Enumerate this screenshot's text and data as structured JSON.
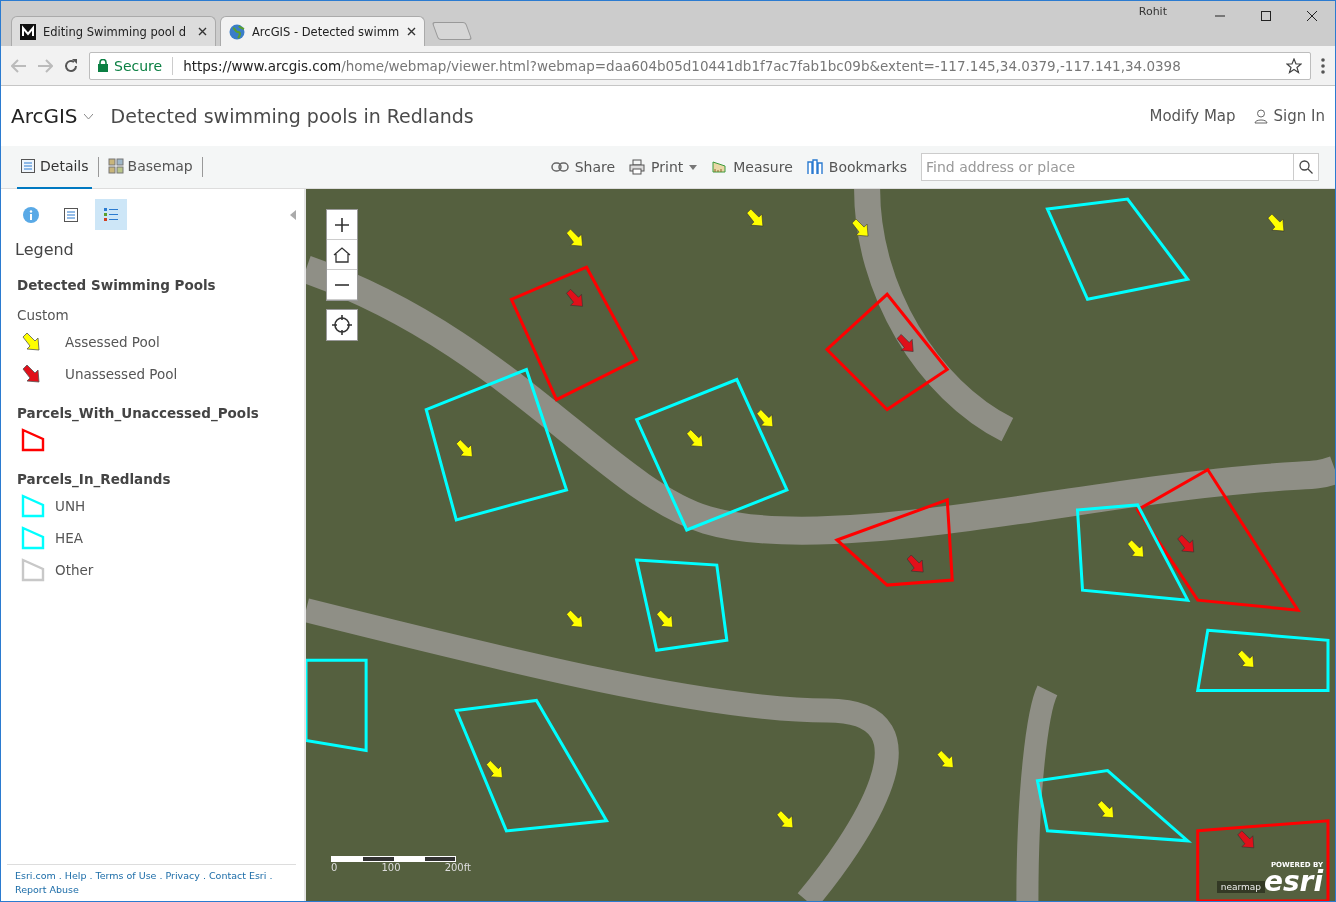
{
  "browser": {
    "tabs": [
      {
        "title": "Editing Swimming pool d",
        "selected": false
      },
      {
        "title": "ArcGIS - Detected swimm",
        "selected": true
      }
    ],
    "profile": "Rohit",
    "secure_label": "Secure",
    "url_host": "https://www.arcgis.com",
    "url_rest": "/home/webmap/viewer.html?webmap=daa604b05d10441db1f7ac7fab1bc09b&extent=-117.145,34.0379,-117.141,34.0398"
  },
  "header": {
    "brand": "ArcGIS",
    "title": "Detected swimming pools in Redlands",
    "links": [
      "Modify Map",
      "Sign In"
    ]
  },
  "toolbar": {
    "tabs": [
      {
        "label": "Details",
        "selected": true
      },
      {
        "label": "Basemap",
        "selected": false
      }
    ],
    "tools": [
      {
        "label": "Share",
        "dropdown": false
      },
      {
        "label": "Print",
        "dropdown": true
      },
      {
        "label": "Measure",
        "dropdown": false
      },
      {
        "label": "Bookmarks",
        "dropdown": false
      }
    ],
    "search": {
      "placeholder": "Find address or place"
    }
  },
  "panel": {
    "icon_tabs": [
      {
        "kind": "about",
        "selected": false
      },
      {
        "kind": "content",
        "selected": false
      },
      {
        "kind": "legend",
        "selected": true
      }
    ],
    "heading": "Legend",
    "layers": [
      {
        "title": "Detected Swimming Pools",
        "subtitle": "Custom",
        "items": [
          {
            "kind": "arrow",
            "color": "#ffff00",
            "label": "Assessed Pool"
          },
          {
            "kind": "arrow",
            "color": "#e0101a",
            "label": "Unassessed Pool"
          }
        ]
      },
      {
        "title": "Parcels_With_Unaccessed_Pools",
        "items": [
          {
            "kind": "parcel",
            "color": "#ff0000"
          }
        ]
      },
      {
        "title": "Parcels_In_Redlands",
        "items": [
          {
            "kind": "parcel",
            "color": "#00ffff",
            "label": "UNH"
          },
          {
            "kind": "parcel",
            "color": "#00ffff",
            "label": "HEA"
          },
          {
            "kind": "parcel",
            "color": "#c8c8c8",
            "label": "Other"
          }
        ]
      }
    ],
    "footer_links": [
      "Esri.com",
      ".",
      "Help",
      ".",
      "Terms of Use",
      ".",
      "Privacy",
      ".",
      "Contact Esri",
      ".",
      "Report Abuse"
    ]
  },
  "map": {
    "scale_labels": [
      "0",
      "100",
      "200ft"
    ],
    "attribution": "nearmap",
    "logo_top": "POWERED BY",
    "logo": "esri"
  }
}
